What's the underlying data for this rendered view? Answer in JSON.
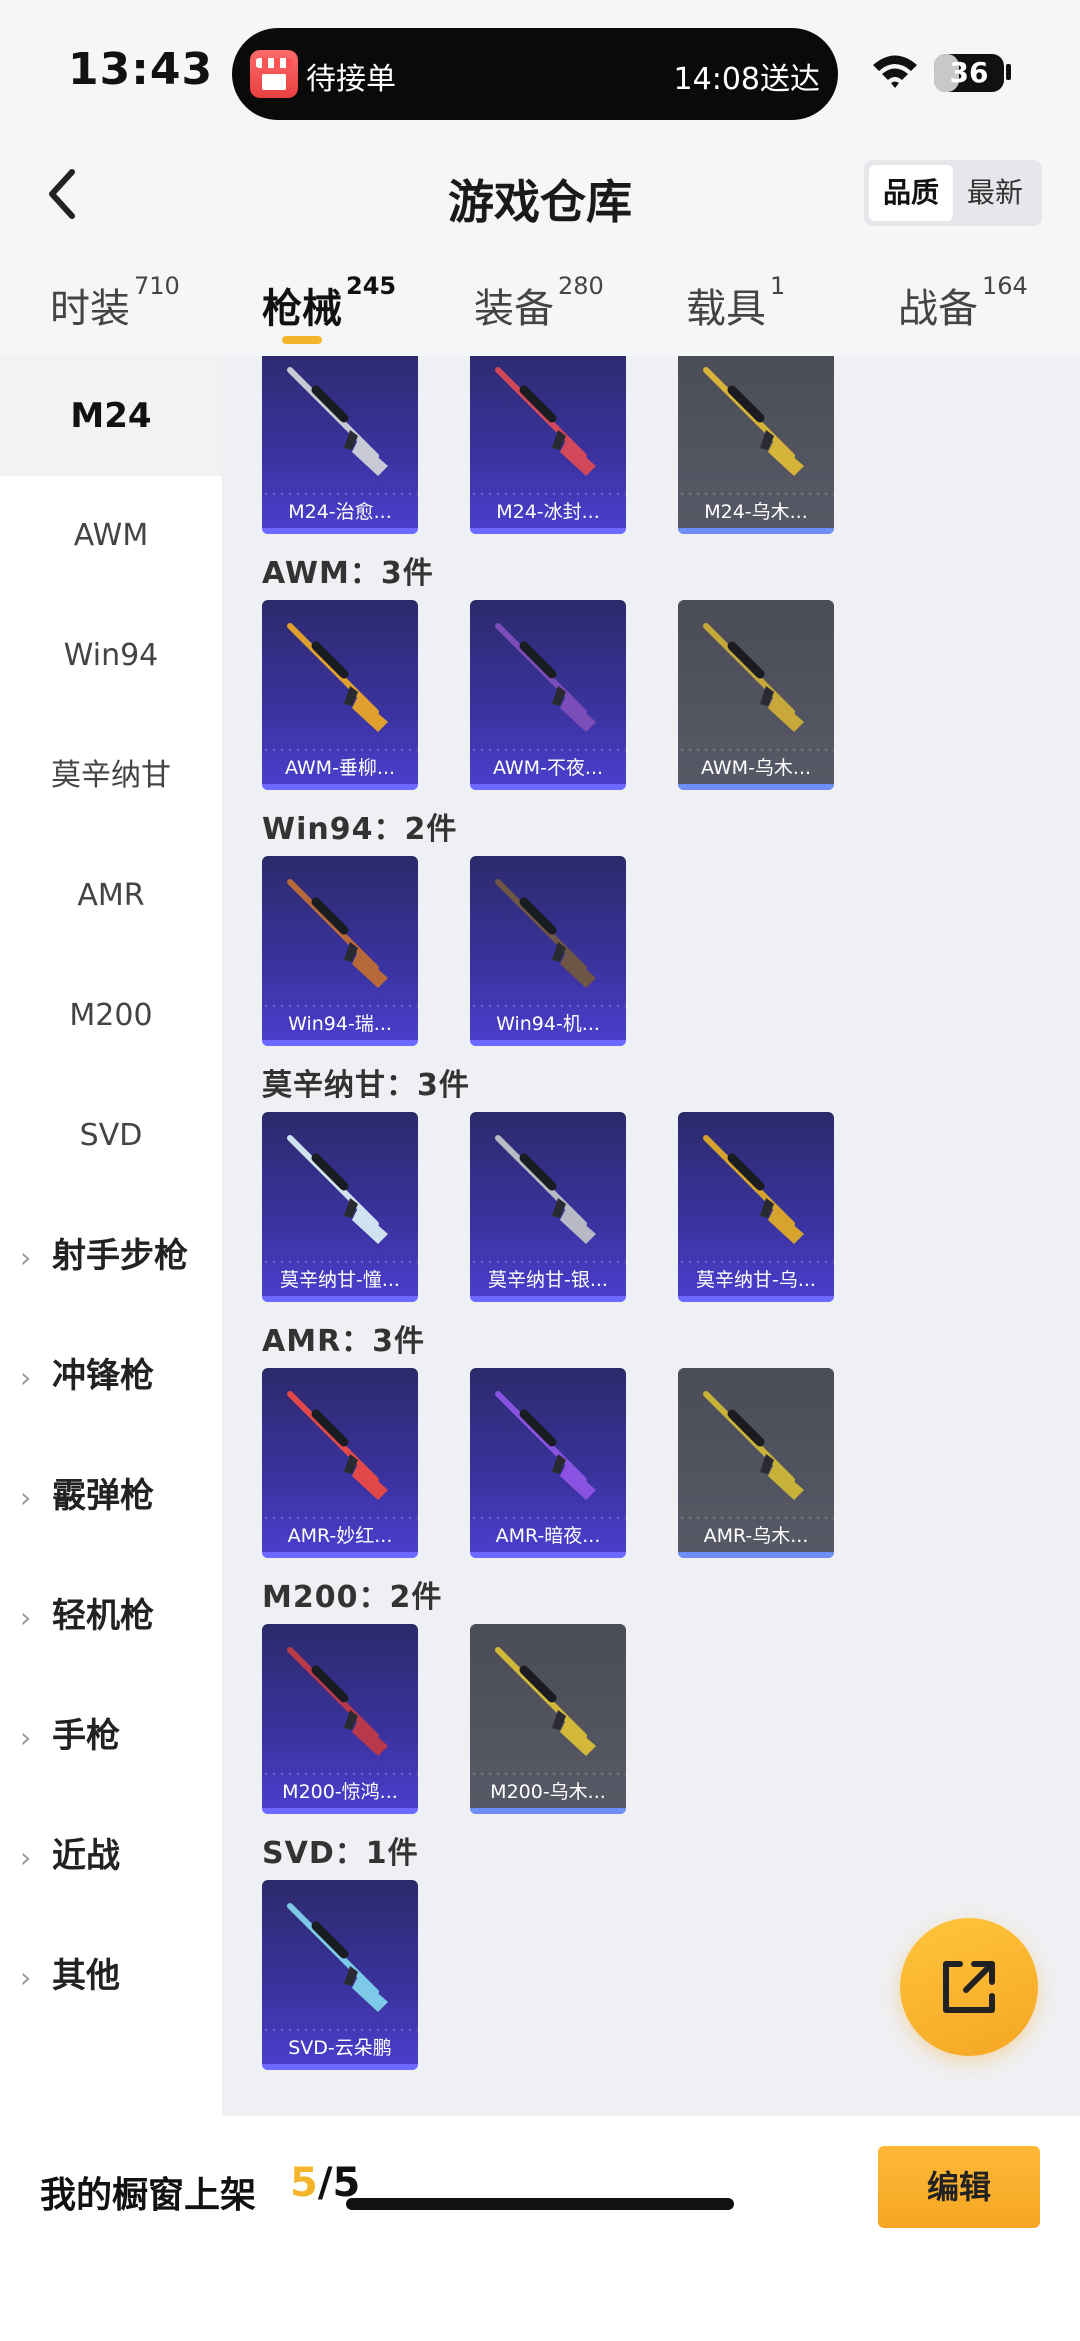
{
  "status_bar": {
    "time": "13:43",
    "island_order_label": "待接单",
    "island_delivery": "14:08送达",
    "battery": "36",
    "battery_level": 0.36
  },
  "header": {
    "title": "游戏仓库",
    "sort_options": [
      "品质",
      "最新"
    ],
    "sort_active": "品质"
  },
  "tabs": [
    {
      "label": "时装",
      "count": "710"
    },
    {
      "label": "枪械",
      "count": "245",
      "active": true
    },
    {
      "label": "装备",
      "count": "280"
    },
    {
      "label": "载具",
      "count": "1"
    },
    {
      "label": "战备",
      "count": "164"
    }
  ],
  "sidebar": {
    "items": [
      "M24",
      "AWM",
      "Win94",
      "莫辛纳甘",
      "AMR",
      "M200",
      "SVD"
    ],
    "active_item": "M24",
    "groups": [
      "射手步枪",
      "冲锋枪",
      "霰弹枪",
      "轻机枪",
      "手枪",
      "近战",
      "其他"
    ]
  },
  "sections": [
    {
      "title": "",
      "items": [
        {
          "label": "M24-治愈...",
          "rarity": "purple",
          "weapon_color": "#c9c9d6"
        },
        {
          "label": "M24-冰封...",
          "rarity": "purple",
          "weapon_color": "#d0485a"
        },
        {
          "label": "M24-乌木...",
          "rarity": "gray",
          "weapon_color": "#d6b43a"
        }
      ]
    },
    {
      "title": "AWM：3件",
      "items": [
        {
          "label": "AWM-垂柳...",
          "rarity": "purple",
          "weapon_color": "#e0a030"
        },
        {
          "label": "AWM-不夜...",
          "rarity": "purple",
          "weapon_color": "#7a4db8"
        },
        {
          "label": "AWM-乌木...",
          "rarity": "gray",
          "weapon_color": "#c9a83a"
        }
      ]
    },
    {
      "title": "Win94：2件",
      "items": [
        {
          "label": "Win94-瑞...",
          "rarity": "purple",
          "weapon_color": "#b8693a"
        },
        {
          "label": "Win94-机...",
          "rarity": "purple",
          "weapon_color": "#6e5646"
        }
      ]
    },
    {
      "title": "莫辛纳甘：3件",
      "items": [
        {
          "label": "莫辛纳甘-憧...",
          "rarity": "purple",
          "weapon_color": "#cfe2f0"
        },
        {
          "label": "莫辛纳甘-银...",
          "rarity": "purple",
          "weapon_color": "#b9b9c6"
        },
        {
          "label": "莫辛纳甘-乌...",
          "rarity": "purple",
          "weapon_color": "#d6a32e"
        }
      ]
    },
    {
      "title": "AMR：3件",
      "items": [
        {
          "label": "AMR-妙红...",
          "rarity": "purple",
          "weapon_color": "#e24848"
        },
        {
          "label": "AMR-暗夜...",
          "rarity": "purple",
          "weapon_color": "#8a52e0"
        },
        {
          "label": "AMR-乌木...",
          "rarity": "gray",
          "weapon_color": "#c9b23a"
        }
      ]
    },
    {
      "title": "M200：2件",
      "items": [
        {
          "label": "M200-惊鸿...",
          "rarity": "purple",
          "weapon_color": "#b83a4a"
        },
        {
          "label": "M200-乌木...",
          "rarity": "gray",
          "weapon_color": "#d4b83a"
        }
      ]
    },
    {
      "title": "SVD：1件",
      "items": [
        {
          "label": "SVD-云朵鹏",
          "rarity": "purple",
          "weapon_color": "#7ec9e8"
        }
      ]
    }
  ],
  "bottom_bar": {
    "shelf_label": "我的橱窗上架",
    "shelf_used": "5",
    "shelf_separator": "/",
    "shelf_total": "5",
    "edit_label": "编辑"
  },
  "colors": {
    "accent": "#f5b52a",
    "purple_card": "#3b33a0",
    "gray_card": "#515360",
    "rarity_purple": "#6b69ff",
    "rarity_gray": "#6e8cf5"
  },
  "icons": {
    "back": "chevron-left-icon",
    "share": "share-external-icon",
    "wifi": "wifi-icon",
    "battery": "battery-icon",
    "shop": "shop-icon",
    "group_expand": "chevron-right-icon"
  }
}
